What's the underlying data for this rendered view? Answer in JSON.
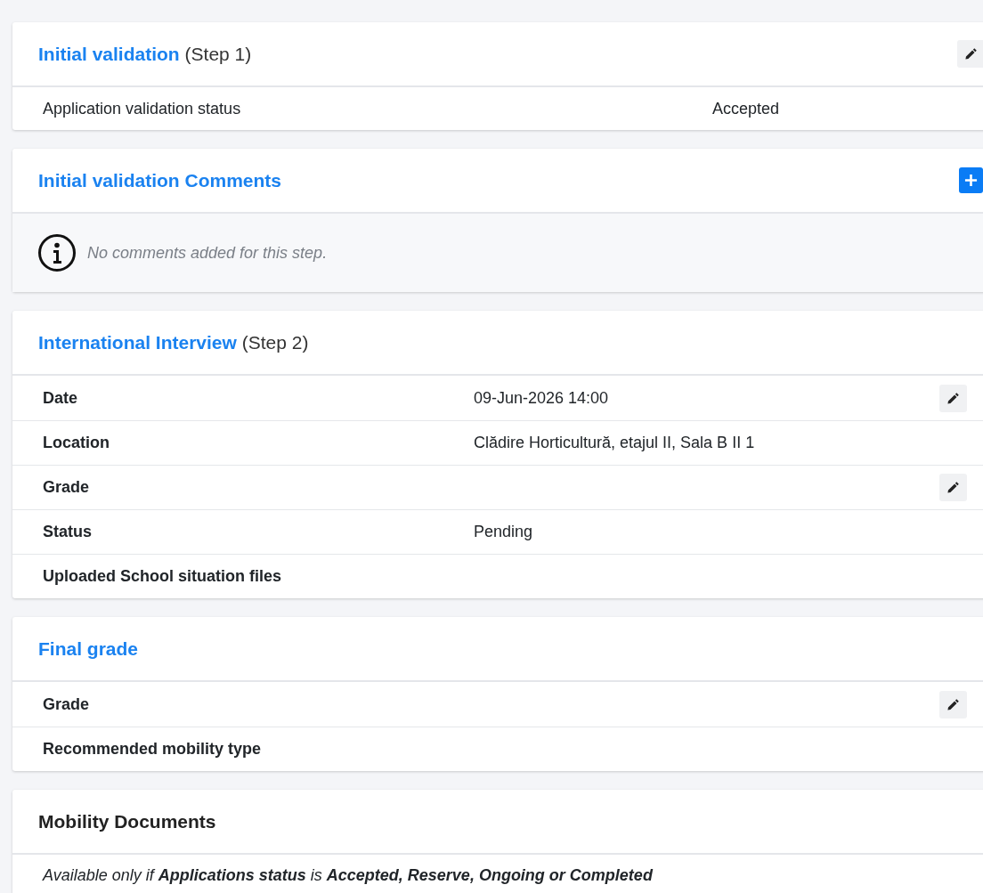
{
  "sections": [
    {
      "kind": "summary",
      "title": "Initial validation",
      "step": "(Step 1)",
      "link": true,
      "editable": true,
      "rows": [
        {
          "label": "Application validation status",
          "value": "Accepted",
          "editable": false
        }
      ]
    },
    {
      "kind": "comments",
      "title": "Initial validation Comments",
      "link": true,
      "addable": true,
      "message": "No comments added for this step."
    },
    {
      "kind": "details",
      "title": "International Interview",
      "step": "(Step 2)",
      "link": true,
      "rows": [
        {
          "label": "Date",
          "value": "09-Jun-2026 14:00",
          "editable": true
        },
        {
          "label": "Location",
          "value": "Clădire Horticultură, etajul II, Sala B II 1",
          "editable": false
        },
        {
          "label": "Grade",
          "editable": true
        },
        {
          "label": "Status",
          "value": "Pending",
          "editable": false
        },
        {
          "label": "Uploaded School situation files",
          "editable": false
        }
      ]
    },
    {
      "kind": "details",
      "title": "Final grade",
      "link": true,
      "rows": [
        {
          "label": "Grade",
          "editable": true
        },
        {
          "label": "Recommended mobility type",
          "editable": false
        }
      ]
    },
    {
      "kind": "note",
      "title": "Mobility Documents",
      "link": false,
      "message": "Available only if **Applications status** is **Accepted, Reserve, Ongoing or Completed**"
    }
  ]
}
